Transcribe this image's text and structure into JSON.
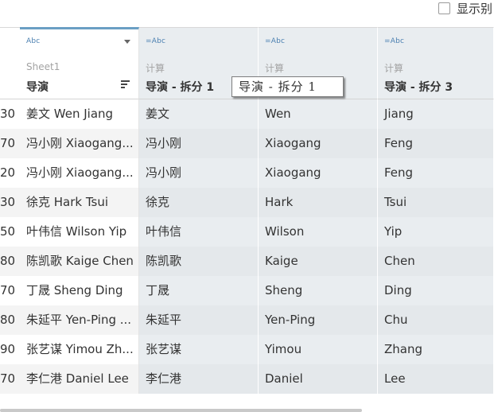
{
  "topbar": {
    "show_label": "显示别"
  },
  "tooltip": {
    "text": "导演 - 拆分 1"
  },
  "columns": [
    {
      "type": "",
      "source": "",
      "name": ""
    },
    {
      "type": "Abc",
      "source": "Sheet1",
      "name": "导演"
    },
    {
      "type": "=Abc",
      "source": "计算",
      "name": "导演 - 拆分 1"
    },
    {
      "type": "=Abc",
      "source": "计算",
      "name": ""
    },
    {
      "type": "=Abc",
      "source": "计算",
      "name": "导演 - 拆分 3"
    }
  ],
  "rows": [
    [
      "30",
      "姜文 Wen Jiang",
      "姜文",
      "Wen",
      "Jiang"
    ],
    [
      "70",
      "冯小刚 Xiaogang...",
      "冯小刚",
      "Xiaogang",
      "Feng"
    ],
    [
      "20",
      "冯小刚 Xiaogang...",
      "冯小刚",
      "Xiaogang",
      "Feng"
    ],
    [
      "30",
      "徐克 Hark Tsui",
      "徐克",
      "Hark",
      "Tsui"
    ],
    [
      "50",
      "叶伟信 Wilson Yip",
      "叶伟信",
      "Wilson",
      "Yip"
    ],
    [
      "80",
      "陈凯歌 Kaige Chen",
      "陈凯歌",
      "Kaige",
      "Chen"
    ],
    [
      "70",
      "丁晟 Sheng Ding",
      "丁晟",
      "Sheng",
      "Ding"
    ],
    [
      "80",
      "朱延平 Yen-Ping ...",
      "朱延平",
      "Yen-Ping",
      "Chu"
    ],
    [
      "90",
      "张艺谋 Yimou Zh...",
      "张艺谋",
      "Yimou",
      "Zhang"
    ],
    [
      "70",
      "李仁港 Daniel Lee",
      "李仁港",
      "Daniel",
      "Lee"
    ]
  ]
}
